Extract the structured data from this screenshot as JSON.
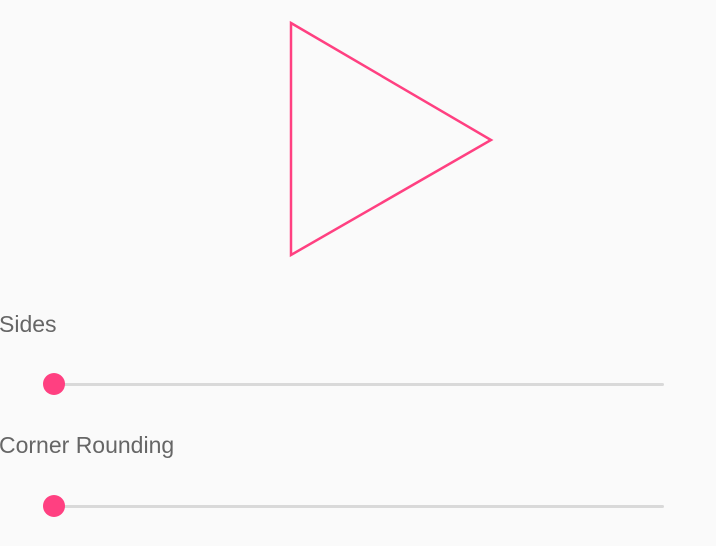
{
  "accent_color": "#ff4081",
  "preview": {
    "shape_icon": "triangle-outline-icon"
  },
  "controls": {
    "sides": {
      "label": "Sides",
      "value_fraction": 0
    },
    "corner_rounding": {
      "label": "Corner Rounding",
      "value_fraction": 0
    }
  }
}
